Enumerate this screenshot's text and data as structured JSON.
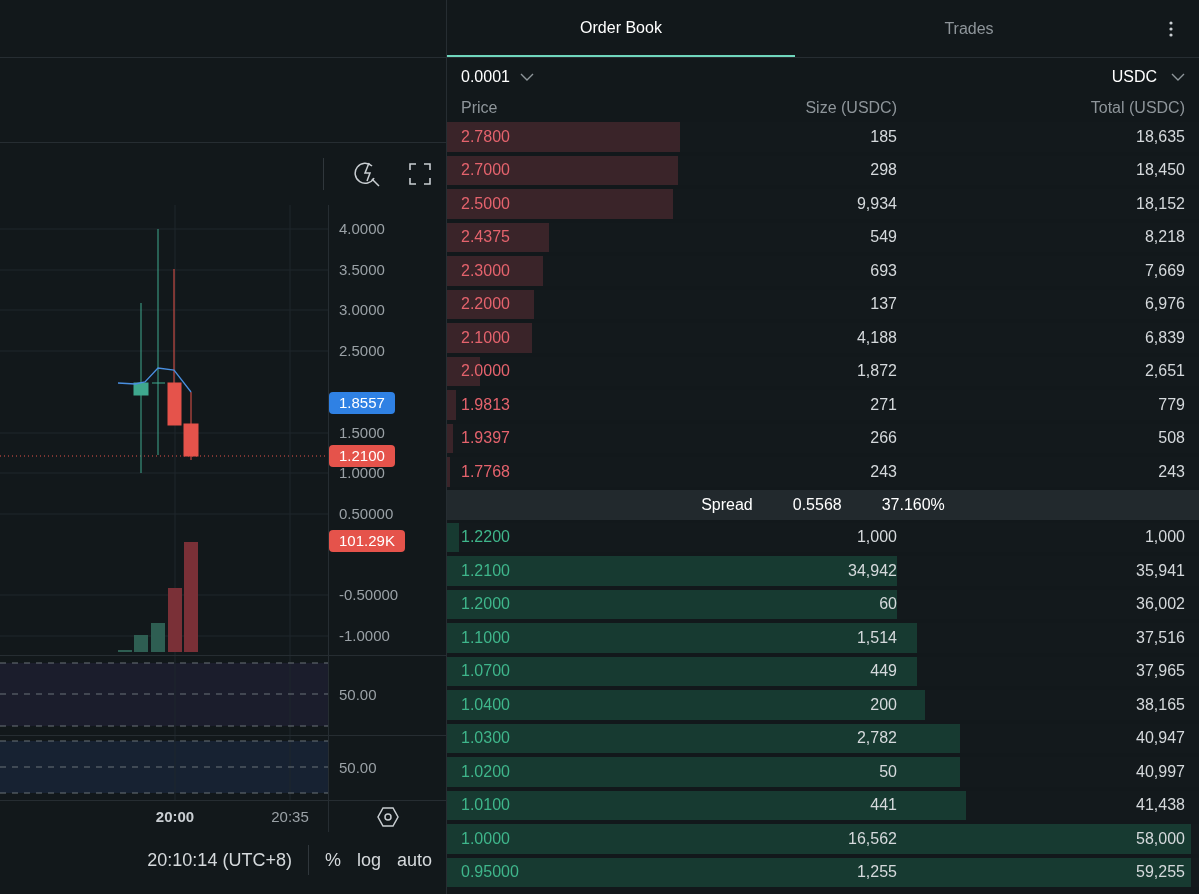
{
  "chart": {
    "price_ticks": [
      "4.0000",
      "3.5000",
      "3.0000",
      "2.5000",
      "1.5000",
      "1.0000",
      "0.50000",
      "-0.50000",
      "-1.0000"
    ],
    "price_tags": [
      {
        "label": "1.8557",
        "color": "#2f81e4"
      },
      {
        "label": "1.2100",
        "color": "#e5534b"
      },
      {
        "label": "101.29K",
        "color": "#e5534b"
      }
    ],
    "pane_labels": [
      "50.00",
      "50.00"
    ],
    "time_labels": [
      {
        "label": "20:00",
        "major": true
      },
      {
        "label": "20:35",
        "major": false
      }
    ],
    "status": {
      "time": "20:10:14 (UTC+8)",
      "options": [
        "%",
        "log",
        "auto"
      ]
    }
  },
  "order_book": {
    "tabs": [
      {
        "label": "Order Book",
        "selected": true
      },
      {
        "label": "Trades",
        "selected": false
      }
    ],
    "tick_size": "0.0001",
    "currency": "USDC",
    "columns": [
      "Price",
      "Size (USDC)",
      "Total (USDC)"
    ],
    "asks": [
      {
        "price": "2.7800",
        "size": "185",
        "total": "18,635",
        "level": 0.31
      },
      {
        "price": "2.7000",
        "size": "298",
        "total": "18,450",
        "level": 0.307
      },
      {
        "price": "2.5000",
        "size": "9,934",
        "total": "18,152",
        "level": 0.3
      },
      {
        "price": "2.4375",
        "size": "549",
        "total": "8,218",
        "level": 0.136
      },
      {
        "price": "2.3000",
        "size": "693",
        "total": "7,669",
        "level": 0.127
      },
      {
        "price": "2.2000",
        "size": "137",
        "total": "6,976",
        "level": 0.116
      },
      {
        "price": "2.1000",
        "size": "4,188",
        "total": "6,839",
        "level": 0.113
      },
      {
        "price": "2.0000",
        "size": "1,872",
        "total": "2,651",
        "level": 0.044
      },
      {
        "price": "1.9813",
        "size": "271",
        "total": "779",
        "level": 0.012
      },
      {
        "price": "1.9397",
        "size": "266",
        "total": "508",
        "level": 0.008
      },
      {
        "price": "1.7768",
        "size": "243",
        "total": "243",
        "level": 0.004
      }
    ],
    "spread": {
      "label": "Spread",
      "value": "0.5568",
      "percent": "37.160%"
    },
    "bids": [
      {
        "price": "1.2200",
        "size": "1,000",
        "total": "1,000",
        "level": 0.016
      },
      {
        "price": "1.2100",
        "size": "34,942",
        "total": "35,941",
        "level": 0.598
      },
      {
        "price": "1.2000",
        "size": "60",
        "total": "36,002",
        "level": 0.598
      },
      {
        "price": "1.1000",
        "size": "1,514",
        "total": "37,516",
        "level": 0.625
      },
      {
        "price": "1.0700",
        "size": "449",
        "total": "37,965",
        "level": 0.625
      },
      {
        "price": "1.0400",
        "size": "200",
        "total": "38,165",
        "level": 0.636
      },
      {
        "price": "1.0300",
        "size": "2,782",
        "total": "40,947",
        "level": 0.682
      },
      {
        "price": "1.0200",
        "size": "50",
        "total": "40,997",
        "level": 0.682
      },
      {
        "price": "1.0100",
        "size": "441",
        "total": "41,438",
        "level": 0.69
      },
      {
        "price": "1.0000",
        "size": "16,562",
        "total": "58,000",
        "level": 0.99
      },
      {
        "price": "0.95000",
        "size": "1,255",
        "total": "59,255",
        "level": 0.99
      }
    ]
  }
}
